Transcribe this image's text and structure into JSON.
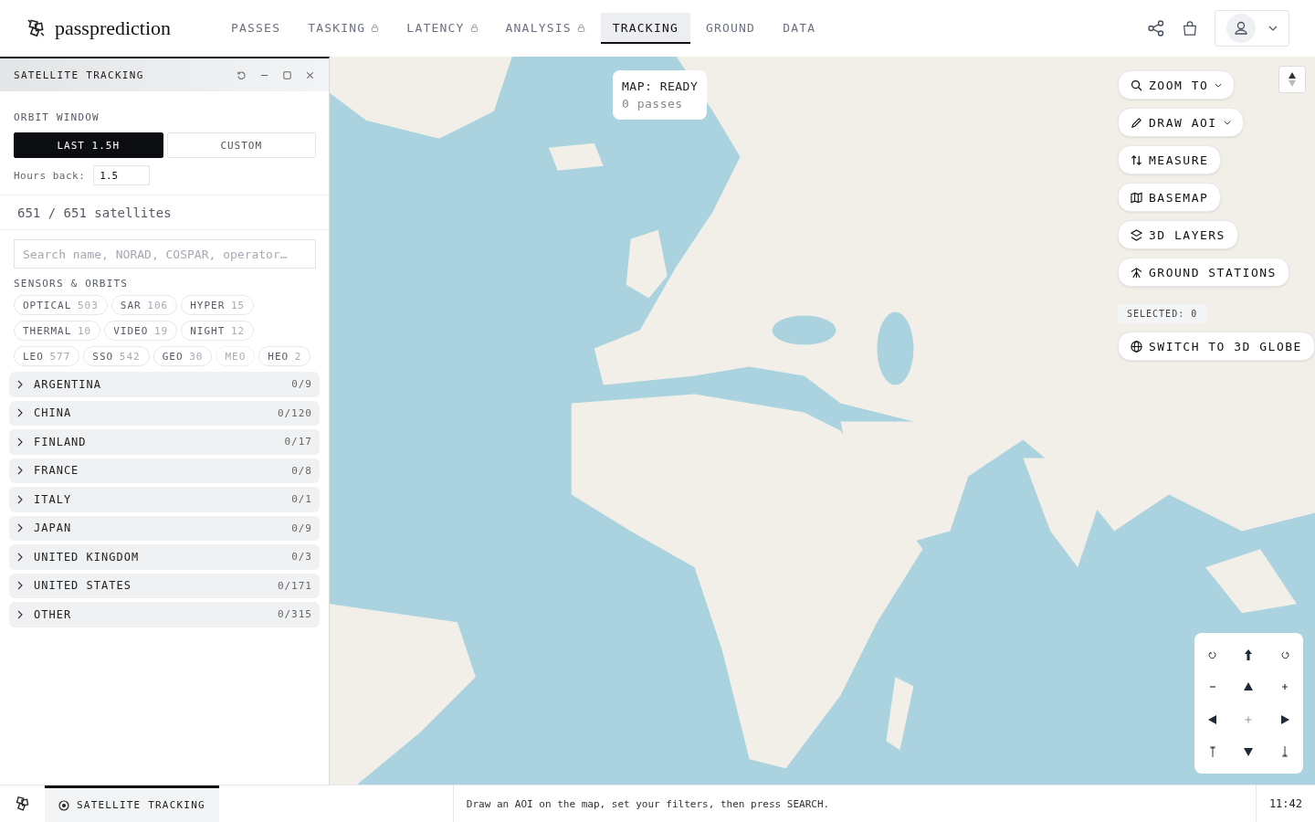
{
  "brand": {
    "name": "passprediction"
  },
  "nav": [
    {
      "label": "PASSES",
      "locked": false,
      "selected": false
    },
    {
      "label": "TASKING",
      "locked": true,
      "selected": false
    },
    {
      "label": "LATENCY",
      "locked": true,
      "selected": false
    },
    {
      "label": "ANALYSIS",
      "locked": true,
      "selected": false
    },
    {
      "label": "TRACKING",
      "locked": false,
      "selected": true
    },
    {
      "label": "GROUND",
      "locked": false,
      "selected": false
    },
    {
      "label": "DATA",
      "locked": false,
      "selected": false
    }
  ],
  "panel": {
    "title": "SATELLITE TRACKING",
    "orbit_window": {
      "label": "ORBIT WINDOW",
      "options": [
        {
          "label": "LAST 1.5H",
          "selected": true
        },
        {
          "label": "CUSTOM",
          "selected": false
        }
      ],
      "hours_label": "Hours back:",
      "hours_value": "1.5"
    },
    "count": "651 / 651 satellites",
    "search_placeholder": "Search name, NORAD, COSPAR, operator…",
    "filters_label": "SENSORS & ORBITS",
    "chip_rows": [
      [
        {
          "label": "OPTICAL",
          "count": "503",
          "disabled": false
        },
        {
          "label": "SAR",
          "count": "106",
          "disabled": false
        },
        {
          "label": "HYPER",
          "count": "15",
          "disabled": false
        }
      ],
      [
        {
          "label": "THERMAL",
          "count": "10",
          "disabled": false
        },
        {
          "label": "VIDEO",
          "count": "19",
          "disabled": false
        },
        {
          "label": "NIGHT",
          "count": "12",
          "disabled": false
        }
      ],
      [
        {
          "label": "LEO",
          "count": "577",
          "disabled": false
        },
        {
          "label": "SSO",
          "count": "542",
          "disabled": false
        },
        {
          "label": "GEO",
          "count": "30",
          "disabled": false
        },
        {
          "label": "MEO",
          "disabled": true
        },
        {
          "label": "HEO",
          "count": "2",
          "disabled": false
        }
      ]
    ],
    "groups": [
      {
        "name": "ARGENTINA",
        "count": "0/9",
        "expanded": false
      },
      {
        "name": "CHINA",
        "count": "0/120",
        "expanded": false
      },
      {
        "name": "FINLAND",
        "count": "0/17",
        "expanded": false
      },
      {
        "name": "FRANCE",
        "count": "0/8",
        "expanded": false
      },
      {
        "name": "ITALY",
        "count": "0/1",
        "expanded": false
      },
      {
        "name": "JAPAN",
        "count": "0/9",
        "expanded": false
      },
      {
        "name": "UNITED KINGDOM",
        "count": "0/3",
        "expanded": false
      },
      {
        "name": "UNITED STATES",
        "count": "0/171",
        "expanded": false
      },
      {
        "name": "OTHER",
        "count": "0/315",
        "expanded": false
      }
    ]
  },
  "map": {
    "status": "MAP: READY",
    "passes": "0 passes",
    "tools": [
      {
        "label": "ZOOM TO",
        "kind": "search",
        "dropdown": true
      },
      {
        "label": "DRAW AOI",
        "kind": "draw",
        "dropdown": true
      },
      {
        "label": "MEASURE",
        "kind": "measure",
        "dropdown": false
      },
      {
        "label": "BASEMAP",
        "kind": "basemap",
        "dropdown": false
      },
      {
        "label": "3D LAYERS",
        "kind": "layers",
        "dropdown": false
      },
      {
        "label": "GROUND STATIONS",
        "kind": "stations",
        "dropdown": false
      }
    ],
    "selected": "SELECTED: 0",
    "globe_button": "SWITCH TO 3D GLOBE"
  },
  "taskbar": {
    "task": "SATELLITE TRACKING",
    "hint": "Draw an AOI on the map, set your filters, then press SEARCH.",
    "time": "11:42"
  }
}
